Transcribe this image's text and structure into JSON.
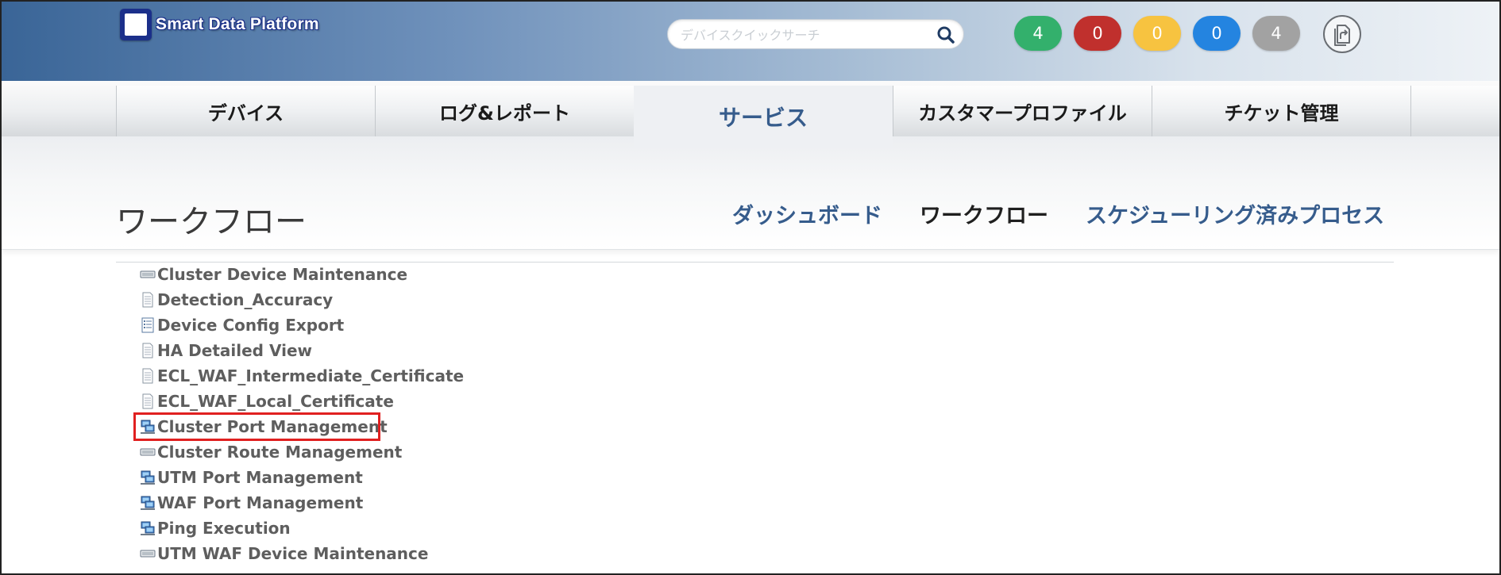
{
  "header": {
    "logo_text": "Smart Data Platform",
    "search": {
      "placeholder": "デバイスクイックサーチ",
      "value": ""
    },
    "status_pills": [
      {
        "value": "4",
        "color": "#33b06c"
      },
      {
        "value": "0",
        "color": "#c0302d"
      },
      {
        "value": "0",
        "color": "#f7c340"
      },
      {
        "value": "0",
        "color": "#2484e0"
      },
      {
        "value": "4",
        "color": "#a2a2a2"
      }
    ],
    "export_icon": "export-icon"
  },
  "nav": {
    "tabs": [
      {
        "label": "デバイス",
        "active": false
      },
      {
        "label": "ログ&レポート",
        "active": false
      },
      {
        "label": "サービス",
        "active": true
      },
      {
        "label": "カスタマープロファイル",
        "active": false
      },
      {
        "label": "チケット管理",
        "active": false
      }
    ]
  },
  "page": {
    "title": "ワークフロー",
    "sub_nav": [
      {
        "label": "ダッシュボード",
        "current": false
      },
      {
        "label": "ワークフロー",
        "current": true
      },
      {
        "label": "スケジューリング済みプロセス",
        "current": false
      }
    ]
  },
  "workflows": [
    {
      "label": "Cluster Device Maintenance",
      "icon": "device-icon"
    },
    {
      "label": "Detection_Accuracy",
      "icon": "document-icon"
    },
    {
      "label": "Device Config Export",
      "icon": "list-document-icon"
    },
    {
      "label": "HA Detailed View",
      "icon": "document-icon"
    },
    {
      "label": "ECL_WAF_Intermediate_Certificate",
      "icon": "document-icon"
    },
    {
      "label": "ECL_WAF_Local_Certificate",
      "icon": "document-icon"
    },
    {
      "label": "Cluster Port Management",
      "icon": "network-icon",
      "highlighted": true
    },
    {
      "label": "Cluster Route Management",
      "icon": "device-icon"
    },
    {
      "label": "UTM Port Management",
      "icon": "network-icon"
    },
    {
      "label": "WAF Port Management",
      "icon": "network-icon"
    },
    {
      "label": "Ping Execution",
      "icon": "network-icon"
    },
    {
      "label": "UTM WAF Device Maintenance",
      "icon": "device-icon"
    }
  ],
  "colors": {
    "accent": "#365c8c",
    "highlight": "#e02020"
  }
}
